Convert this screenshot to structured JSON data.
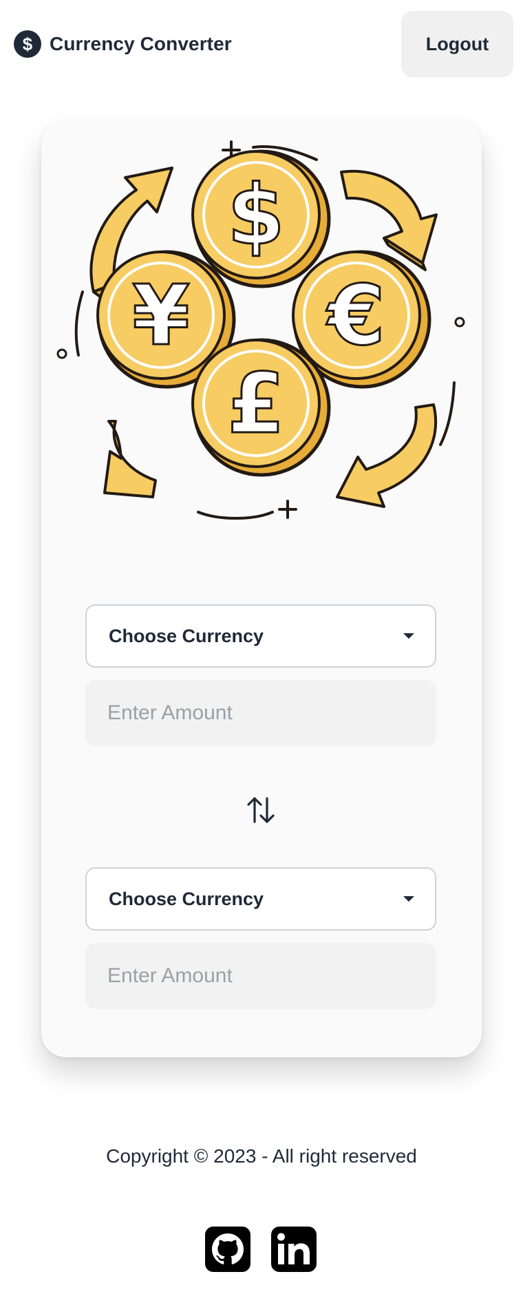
{
  "navbar": {
    "brand_icon": "dollar-coin-icon",
    "title": "Currency Converter",
    "logout_label": "Logout"
  },
  "hero": {
    "icon": "currency-exchange-coins-illustration",
    "coin_symbols": [
      "$",
      "¥",
      "€",
      "£"
    ],
    "colors": {
      "coin": "#f6cc63",
      "coin_shade": "#e7ad38",
      "outline": "#231a14"
    }
  },
  "converter": {
    "from": {
      "currency_label": "Choose Currency",
      "amount_placeholder": "Enter Amount"
    },
    "swap_icon": "swap-vertical-arrows-icon",
    "to": {
      "currency_label": "Choose Currency",
      "amount_placeholder": "Enter Amount"
    }
  },
  "footer": {
    "copyright": "Copyright © 2023 - All right reserved",
    "social": [
      {
        "icon": "github-icon"
      },
      {
        "icon": "linkedin-icon"
      }
    ]
  },
  "colors": {
    "text": "#1f2937",
    "card_bg": "#fafafa",
    "button_bg": "#f0f0f0",
    "input_bg": "#f2f2f2"
  }
}
